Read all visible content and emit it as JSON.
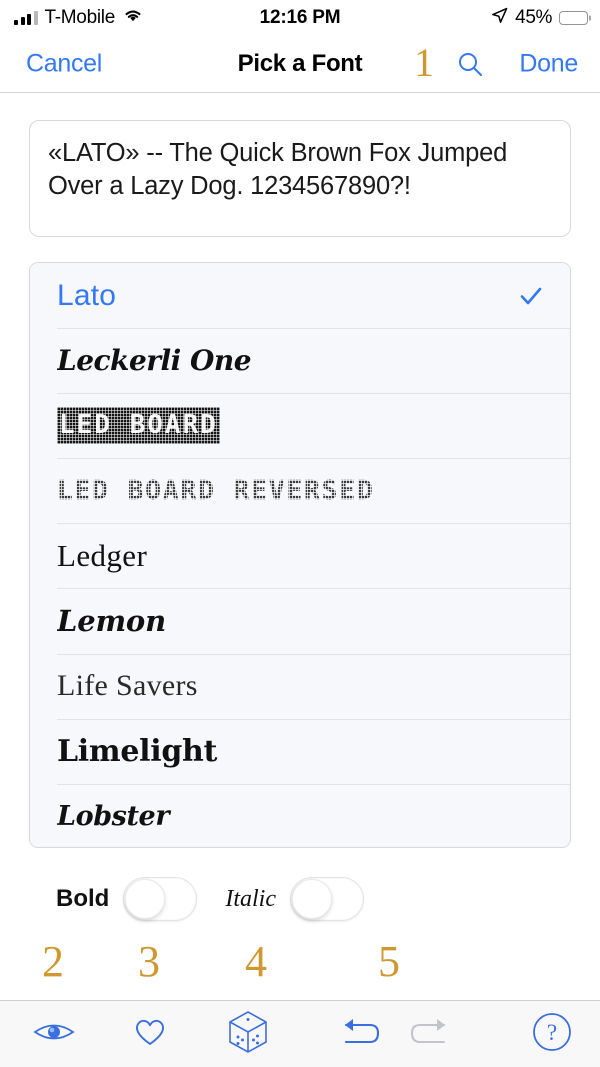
{
  "status_bar": {
    "carrier": "T-Mobile",
    "wifi_icon": "wifi-icon",
    "signal_icon": "cellular-signal-icon",
    "time": "12:16 PM",
    "location_icon": "location-arrow-icon",
    "battery_percent": "45%",
    "battery_level": 45
  },
  "nav_bar": {
    "cancel_label": "Cancel",
    "title": "Pick a Font",
    "done_label": "Done",
    "search_icon": "search-icon",
    "annotation": "1"
  },
  "preview": {
    "text": "«LATO» -- The Quick Brown Fox Jumped Over a Lazy Dog. 1234567890?!"
  },
  "font_list": {
    "selected": "Lato",
    "check_icon": "checkmark-icon",
    "items": [
      {
        "name": "Lato",
        "style": "f-lato",
        "selected": true
      },
      {
        "name": "Leckerli One",
        "style": "f-leckerli",
        "selected": false
      },
      {
        "name": "LED BOARD",
        "style": "f-ledboard",
        "selected": false
      },
      {
        "name": "LED BOARD REVERSED",
        "style": "f-ledrev",
        "selected": false
      },
      {
        "name": "Ledger",
        "style": "f-ledger",
        "selected": false
      },
      {
        "name": "Lemon",
        "style": "f-lemon",
        "selected": false
      },
      {
        "name": "Life Savers",
        "style": "f-lifesav",
        "selected": false
      },
      {
        "name": "Limelight",
        "style": "f-limelight",
        "selected": false
      },
      {
        "name": "Lobster",
        "style": "f-lobster",
        "selected": false
      }
    ]
  },
  "style_toggles": {
    "bold_label": "Bold",
    "bold_on": false,
    "italic_label": "Italic",
    "italic_on": false
  },
  "annotations": {
    "numbers": [
      "2",
      "3",
      "4",
      "5"
    ]
  },
  "toolbar": {
    "items": [
      {
        "name": "preview-eye-button",
        "icon": "eye-icon",
        "enabled": true
      },
      {
        "name": "favorite-button",
        "icon": "heart-icon",
        "enabled": true
      },
      {
        "name": "randomize-button",
        "icon": "dice-cube-icon",
        "enabled": true
      },
      {
        "name": "undo-button",
        "icon": "undo-arrow-icon",
        "enabled": true
      },
      {
        "name": "redo-button",
        "icon": "redo-arrow-icon",
        "enabled": false
      },
      {
        "name": "help-button",
        "icon": "question-circle-icon",
        "enabled": true
      }
    ]
  },
  "colors": {
    "accent_blue": "#3478f6",
    "toolbar_blue": "#3a6fe0",
    "annotation_orange": "#cf9830",
    "list_background": "#f7f8fb",
    "separator": "#e2e3e8",
    "disabled_gray": "#c3c4c9"
  }
}
